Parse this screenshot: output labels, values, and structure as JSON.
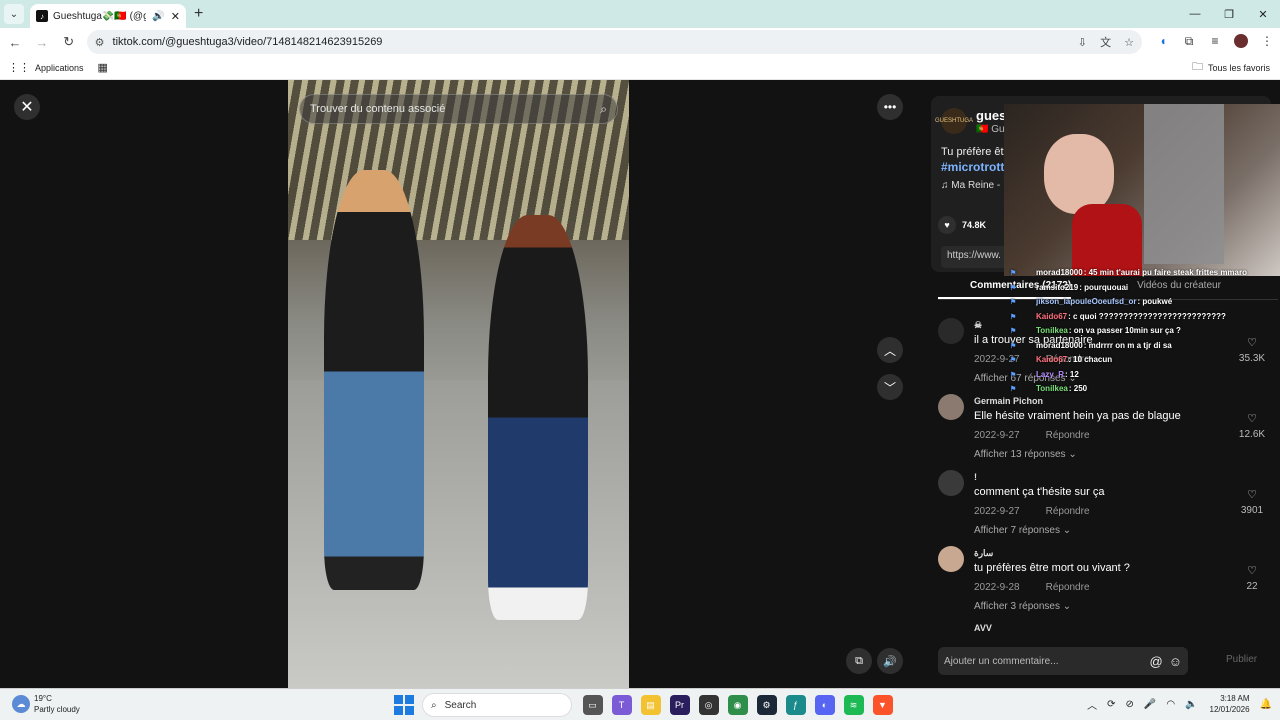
{
  "browser": {
    "tab_title": "Gueshtuga💸🇵🇹 (@gues",
    "url": "tiktok.com/@gueshtuga3/video/7148148214623915269",
    "bookmarks": {
      "apps": "Applications",
      "favorites": "Tous les favoris"
    }
  },
  "video": {
    "search_placeholder": "Trouver du contenu associé"
  },
  "creator": {
    "avatar_label": "GUESHTUGA",
    "name": "gues",
    "sub": "🇵🇹 Gue",
    "description": "Tu préfère êt",
    "tag": "#microtrottc",
    "music": "Ma Reine -",
    "likes": "74.8K",
    "link": "https://www."
  },
  "panel_tabs": [
    "Commentaires (2172)",
    "Vidéos du créateur"
  ],
  "comments": [
    {
      "user": "☠",
      "text": "il a trouver sa partenaire",
      "date": "2022-9-27",
      "reply": "Répondre",
      "more": "Afficher 67 réponses",
      "likes": "35.3K"
    },
    {
      "user": "Germain Pichon",
      "text": "Elle hésite vraiment hein ya pas de blague",
      "date": "2022-9-27",
      "reply": "Répondre",
      "more": "Afficher 13 réponses",
      "likes": "12.6K"
    },
    {
      "user": "!",
      "text": "comment ça t'hésite sur ça",
      "date": "2022-9-27",
      "reply": "Répondre",
      "more": "Afficher 7 réponses",
      "likes": "3901"
    },
    {
      "user": "سارة",
      "text": "tu préfères être mort ou vivant ?",
      "date": "2022-9-28",
      "reply": "Répondre",
      "more": "Afficher 3 réponses",
      "likes": "22"
    }
  ],
  "next_comment_user": "AVV",
  "comment_input": {
    "placeholder": "Ajouter un commentaire...",
    "publish": "Publier"
  },
  "stream_chat": [
    {
      "user": "morad18000",
      "msg": "45 min t'aurai pu faire steak frittes mmaro"
    },
    {
      "user": "ramsito219",
      "msg": "pourquouai"
    },
    {
      "user": "jikson_lapouleOoeufsd_or",
      "msg": "poukwé"
    },
    {
      "user": "Kaido67",
      "msg": "c quoi ??????????????????????????"
    },
    {
      "user": "Tonilkea",
      "msg": "on va passer 10min sur ça ?"
    },
    {
      "user": "morad18000",
      "msg": "mdrrrr on m a tjr di sa"
    },
    {
      "user": "Kaido67",
      "msg": "10 chacun"
    },
    {
      "user": "Lazy_R",
      "msg": "12"
    },
    {
      "user": "Tonilkea",
      "msg": "250"
    }
  ],
  "taskbar": {
    "temp": "19°C",
    "weather": "Partly cloudy",
    "search": "Search",
    "time": "3:18 AM",
    "date": "12/01/2026"
  }
}
